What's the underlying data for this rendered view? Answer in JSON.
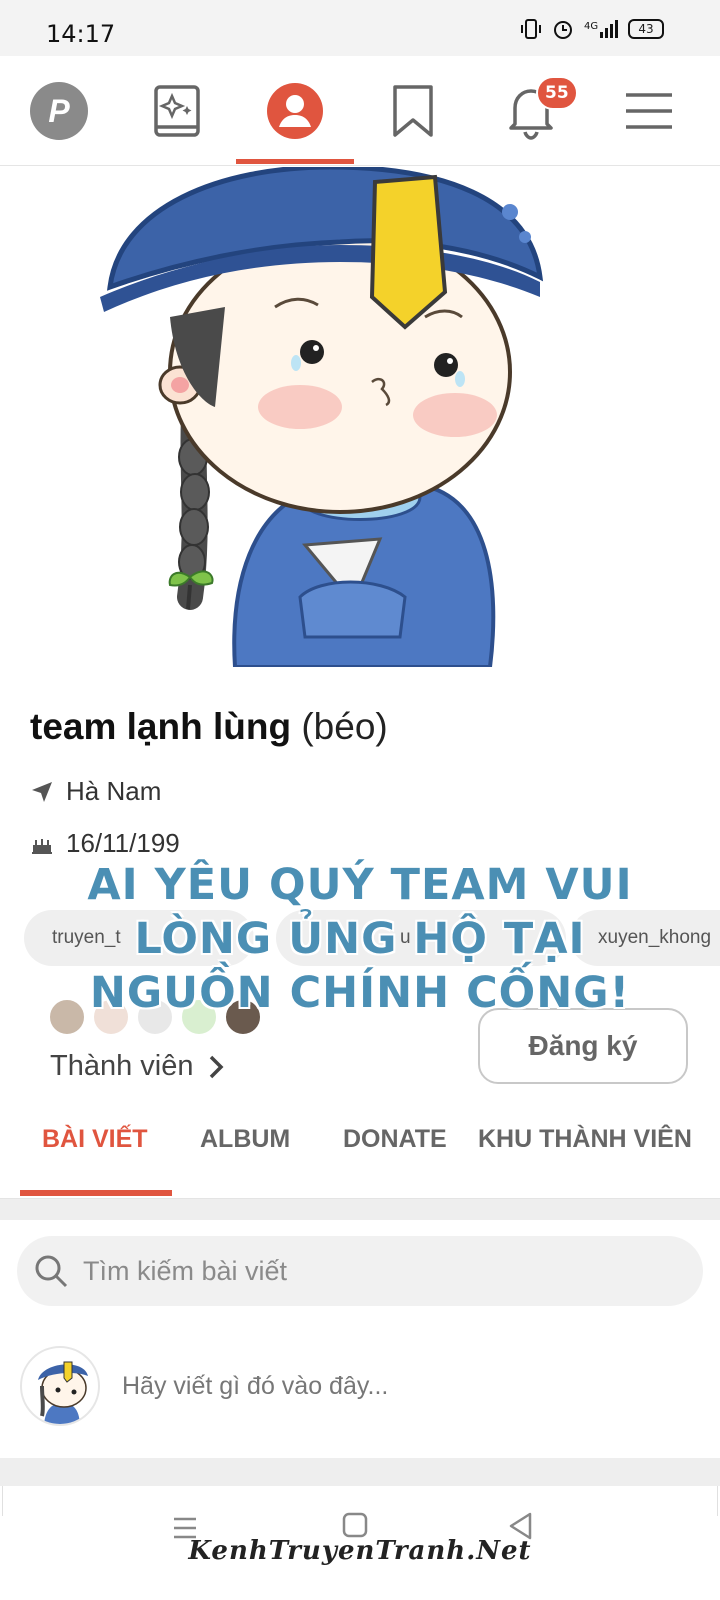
{
  "status_bar": {
    "time": "14:17",
    "battery": "43",
    "network": "4G"
  },
  "top_nav": {
    "items": [
      {
        "name": "logo",
        "label": "P"
      },
      {
        "name": "stories",
        "icon": "sparkle-book-icon"
      },
      {
        "name": "profile",
        "icon": "user-circle-icon",
        "active": true
      },
      {
        "name": "bookmarks",
        "icon": "bookmark-icon"
      },
      {
        "name": "notifications",
        "icon": "bell-icon",
        "badge": "55"
      },
      {
        "name": "menu",
        "icon": "hamburger-icon"
      }
    ]
  },
  "profile": {
    "name": "team lạnh lùng",
    "name_suffix": "(béo)",
    "location": "Hà Nam",
    "birthday": "16/11/199",
    "chips": [
      "truyen_t",
      "u",
      "xuyen_khong"
    ],
    "members_label": "Thành viên",
    "subscribe_label": "Đăng ký"
  },
  "tabs": [
    {
      "label": "BÀI VIẾT",
      "active": true
    },
    {
      "label": "ALBUM"
    },
    {
      "label": "DONATE"
    },
    {
      "label": "KHU THÀNH VIÊN"
    }
  ],
  "search": {
    "placeholder": "Tìm kiếm bài viết"
  },
  "composer": {
    "placeholder": "Hãy viết gì đó vào đây..."
  },
  "overlay": {
    "line1": "AI YÊU QUÝ TEAM VUI",
    "line2": "LÒNG ỦNG HỘ TẠI",
    "line3": "NGUỒN CHÍNH CỐNG!",
    "watermark": "KenhTruyenTranh.Net"
  },
  "colors": {
    "accent": "#e0553f",
    "promo": "#4b8fb4",
    "hat": "#3c63a8",
    "robe": "#4d78c2"
  }
}
